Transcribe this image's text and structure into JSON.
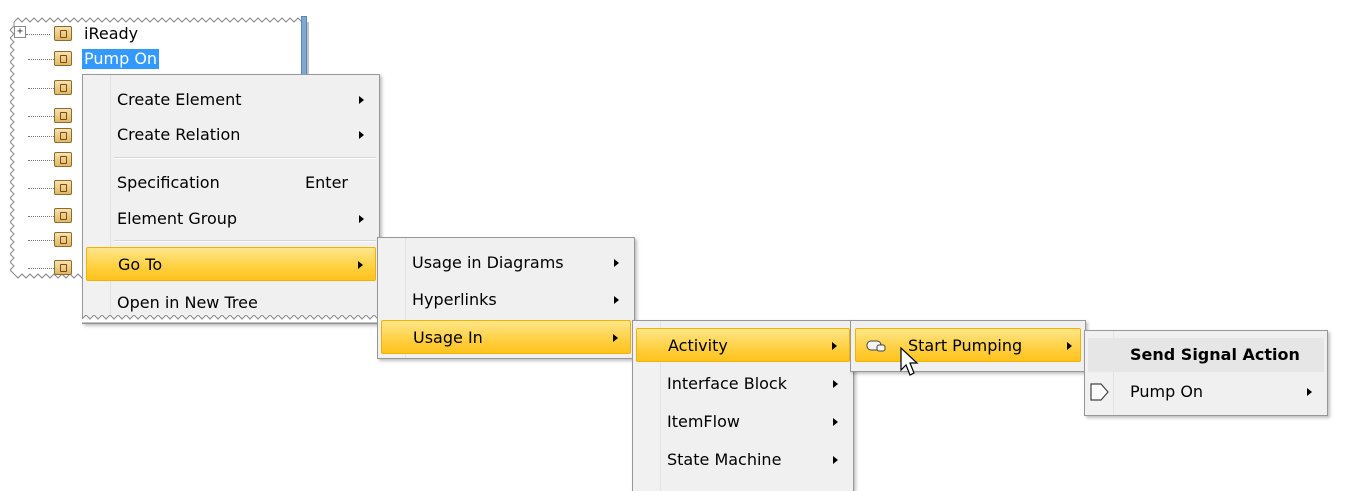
{
  "tree": {
    "items": [
      {
        "label": "iReady",
        "selected": false,
        "expander": "+"
      },
      {
        "label": "Pump On",
        "selected": true
      },
      {
        "label": ""
      },
      {
        "label": ""
      },
      {
        "label": ""
      },
      {
        "label": ""
      },
      {
        "label": ""
      },
      {
        "label": ""
      },
      {
        "label": ""
      },
      {
        "label": ""
      }
    ]
  },
  "menu1": {
    "items": [
      {
        "label": "Create Element",
        "submenu": true
      },
      {
        "label": "Create Relation",
        "submenu": true
      },
      {
        "label": "Specification",
        "shortcut": "Enter"
      },
      {
        "label": "Element Group",
        "submenu": true
      },
      {
        "label": "Go To",
        "submenu": true,
        "highlighted": true
      },
      {
        "label": "Open in New Tree"
      }
    ]
  },
  "menu2": {
    "items": [
      {
        "label": "Usage in Diagrams",
        "submenu": true
      },
      {
        "label": "Hyperlinks",
        "submenu": true
      },
      {
        "label": "Usage In",
        "submenu": true,
        "highlighted": true
      }
    ]
  },
  "menu3": {
    "items": [
      {
        "label": "Activity",
        "submenu": true,
        "highlighted": true
      },
      {
        "label": "Interface Block",
        "submenu": true
      },
      {
        "label": "ItemFlow",
        "submenu": true
      },
      {
        "label": "State Machine",
        "submenu": true
      }
    ]
  },
  "menu4": {
    "items": [
      {
        "label": "Start Pumping",
        "submenu": true,
        "highlighted": true,
        "icon": "activity-icon"
      }
    ]
  },
  "menu5": {
    "header": "Send Signal Action",
    "items": [
      {
        "label": "Pump On",
        "submenu": true,
        "icon": "send-signal-icon"
      }
    ]
  },
  "colors": {
    "highlight": "#ffd040",
    "selection": "#3399ff",
    "menu_bg": "#f0f0f0"
  }
}
